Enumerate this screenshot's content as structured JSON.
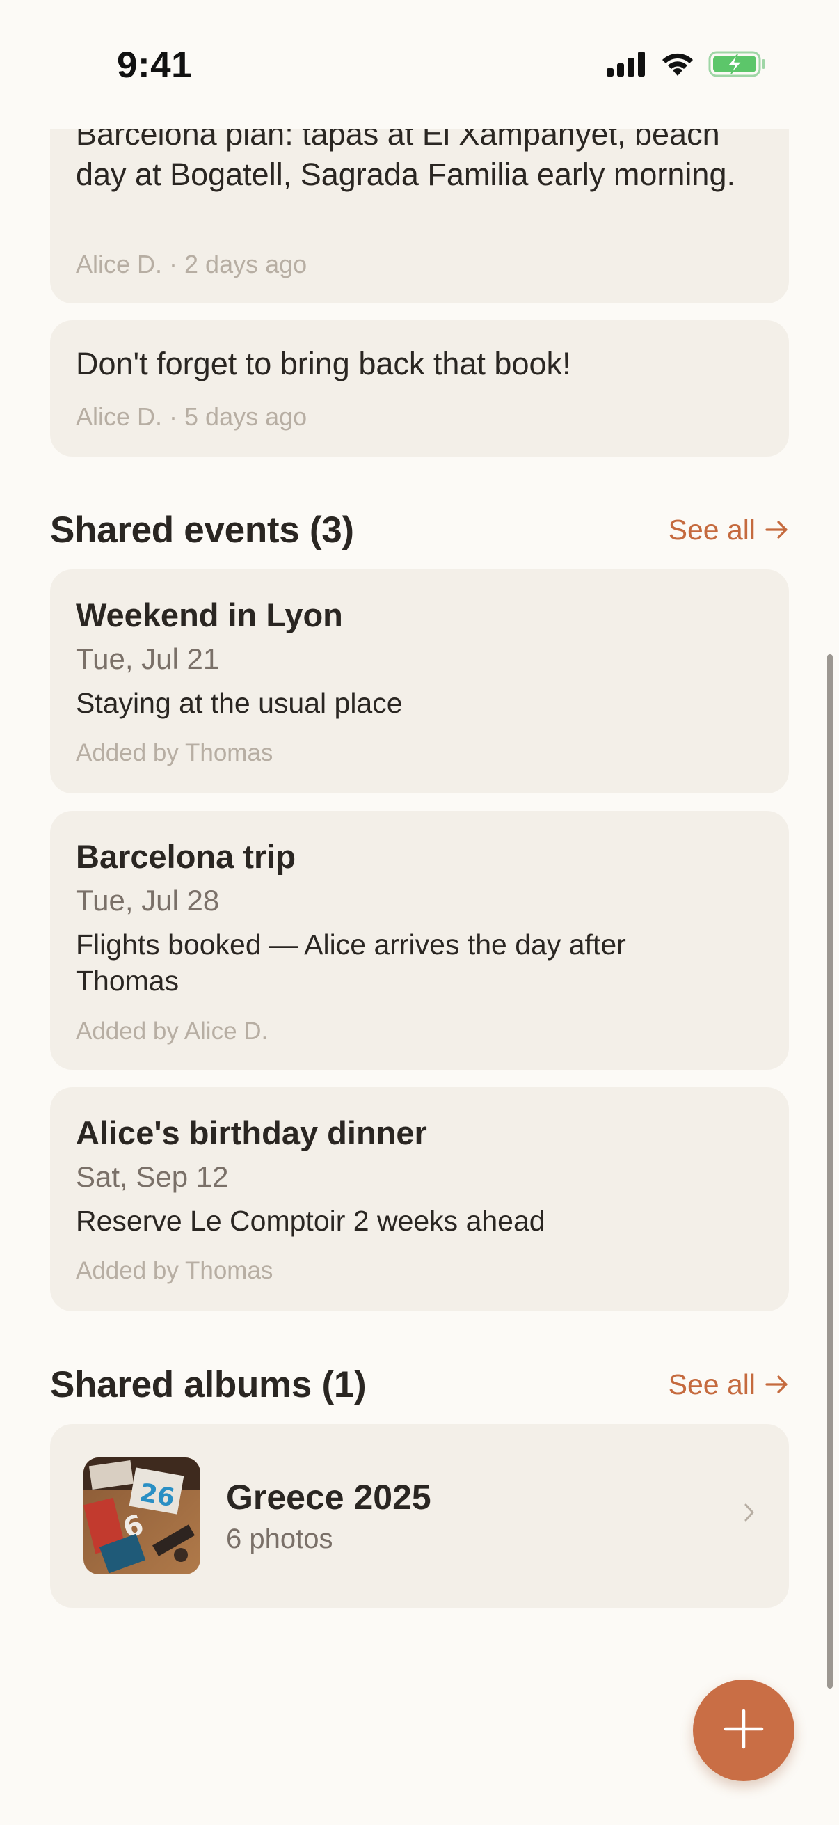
{
  "status_bar": {
    "time": "9:41"
  },
  "notes": [
    {
      "text": "Barcelona plan: tapas at El Xampanyet, beach day at Bogatell, Sagrada Familia early morning.",
      "meta": "Alice D. · 2 days ago"
    },
    {
      "text": "Don't forget to bring back that book!",
      "meta": "Alice D. · 5 days ago"
    }
  ],
  "events_section": {
    "title": "Shared events (3)",
    "see_all": "See all",
    "items": [
      {
        "title": "Weekend in Lyon",
        "date": "Tue, Jul 21",
        "description": "Staying at the usual place",
        "added_by": "Added by Thomas"
      },
      {
        "title": "Barcelona trip",
        "date": "Tue, Jul 28",
        "description": "Flights booked — Alice arrives the day after Thomas",
        "added_by": "Added by Alice D."
      },
      {
        "title": "Alice's birthday dinner",
        "date": "Sat, Sep 12",
        "description": "Reserve Le Comptoir 2 weeks ahead",
        "added_by": "Added by Thomas"
      }
    ]
  },
  "albums_section": {
    "title": "Shared albums (1)",
    "see_all": "See all",
    "items": [
      {
        "name": "Greece 2025",
        "count": "6 photos"
      }
    ]
  },
  "colors": {
    "background": "#FCFAF6",
    "card": "#F3EFE8",
    "accent": "#C96E45",
    "link": "#C56A3E",
    "battery_green": "#5CC66A"
  },
  "icons": {
    "signal": "cellular-signal-icon",
    "wifi": "wifi-icon",
    "battery": "battery-charging-icon",
    "arrow": "arrow-right-icon",
    "chevron": "chevron-right-icon",
    "fab": "plus-icon"
  }
}
